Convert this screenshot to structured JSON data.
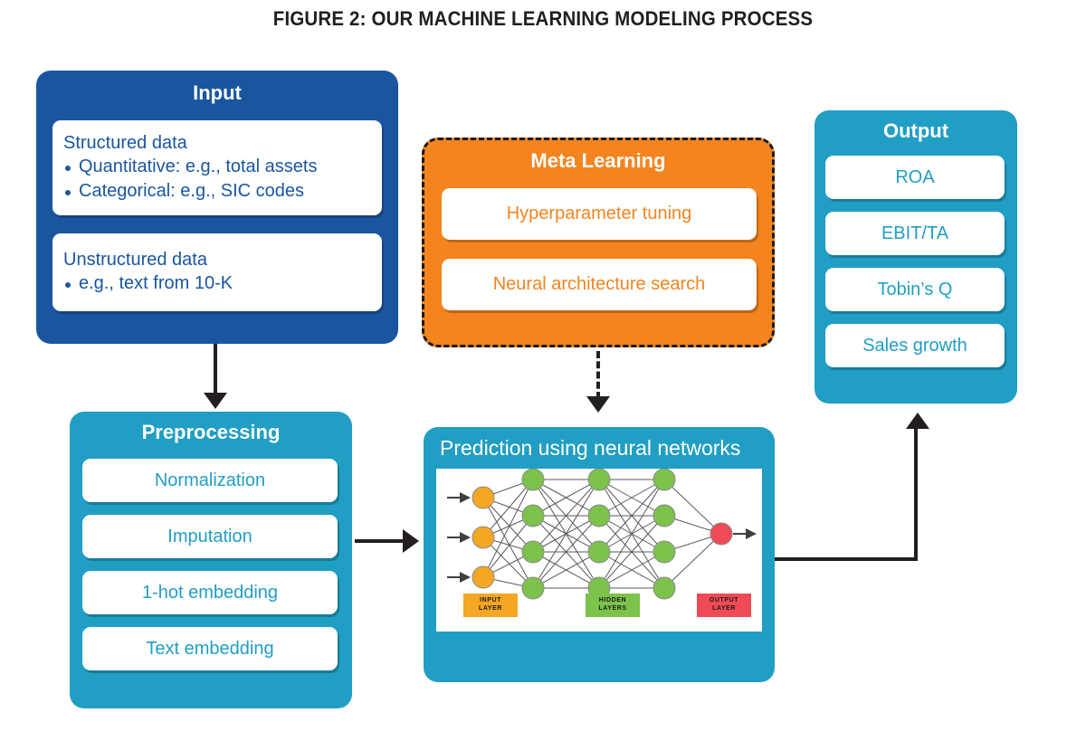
{
  "figure": {
    "title": "FIGURE 2: OUR MACHINE LEARNING MODELING PROCESS"
  },
  "colors": {
    "dark_blue": "#1a56a0",
    "teal": "#219ec4",
    "orange": "#f3841f",
    "node_input": "#f5a623",
    "node_hidden": "#7cc24b",
    "node_output": "#ef4b56",
    "arrow": "#231f20",
    "card_bg": "#ffffff"
  },
  "input": {
    "title": "Input",
    "structured": {
      "heading": "Structured data",
      "bullets": [
        "Quantitative: e.g., total assets",
        "Categorical: e.g., SIC codes"
      ]
    },
    "unstructured": {
      "heading": "Unstructured data",
      "bullets": [
        "e.g., text from 10-K"
      ]
    }
  },
  "meta_learning": {
    "title": "Meta Learning",
    "items": [
      {
        "label": "Hyperparameter tuning"
      },
      {
        "label": "Neural architecture search"
      }
    ]
  },
  "output": {
    "title": "Output",
    "items": [
      {
        "label": "ROA"
      },
      {
        "label": "EBIT/TA"
      },
      {
        "label": "Tobin’s Q"
      },
      {
        "label": "Sales growth"
      }
    ]
  },
  "preprocessing": {
    "title": "Preprocessing",
    "items": [
      {
        "label": "Normalization"
      },
      {
        "label": "Imputation"
      },
      {
        "label": "1-hot embedding"
      },
      {
        "label": "Text embedding"
      }
    ]
  },
  "prediction": {
    "title": "Prediction using neural networks",
    "network": {
      "input_layer_label": "INPUT\nLAYER",
      "hidden_layer_label": "HIDDEN\nLAYERS",
      "output_layer_label": "OUTPUT\nLAYER",
      "input_nodes": 3,
      "hidden_layers": 3,
      "hidden_nodes_per_layer": 4,
      "output_nodes": 1
    }
  },
  "flow": {
    "input_to_preprocessing": "arrow-down",
    "preprocessing_to_prediction": "arrow-right",
    "meta_learning_to_prediction": "dashed-arrow-down",
    "prediction_to_output": "elbow-arrow-up"
  }
}
